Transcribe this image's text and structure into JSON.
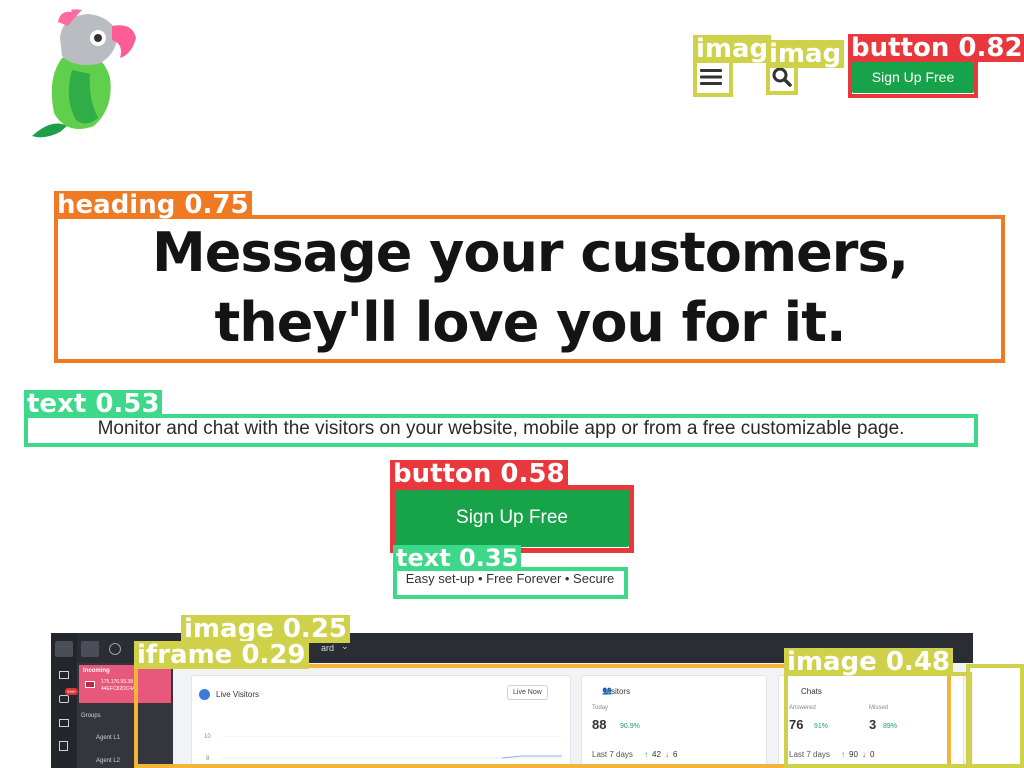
{
  "header": {
    "logo": "parrot-logo",
    "menu_icon": "hamburger-icon",
    "search_icon": "search-icon",
    "signup_label": "Sign Up Free"
  },
  "hero": {
    "title_line1": "Message your customers,",
    "title_line2": "they'll love you for it.",
    "subtitle": "Monitor and chat with the visitors on your website, mobile app or from a free customizable page.",
    "cta_label": "Sign Up Free",
    "tagline": "Easy set-up • Free Forever • Secure"
  },
  "dashboard": {
    "incoming_label": "Incoming",
    "incoming_ip": "175.176.93.38",
    "incoming_id": "44EFC82DC4A...",
    "incoming_badge": "999+",
    "groups_label": "Groups",
    "agent1": "Agent L1",
    "agent2": "Agent L2",
    "dropdown_suffix": "ard",
    "live_visitors": "Live Visitors",
    "live_now": "Live Now",
    "chart_tick_10": "10",
    "chart_tick_8": "8",
    "visitors_title": "Visitors",
    "visitors_today_label": "Today",
    "visitors_today_value": "88",
    "visitors_today_pct": "90.9%",
    "visitors_last7_label": "Last 7 days",
    "visitors_last7_up": "42",
    "visitors_last7_down": "6",
    "chats_title": "Chats",
    "chats_answered_label": "Answered",
    "chats_answered_value": "76",
    "chats_answered_pct": "91%",
    "chats_missed_label": "Missed",
    "chats_missed_value": "3",
    "chats_missed_pct": "89%",
    "chats_last7_label": "Last 7 days",
    "chats_last7_up": "90",
    "chats_last7_down": "0"
  },
  "detections": {
    "heading": "heading 0.75",
    "text1": "text 0.53",
    "button1": "button 0.58",
    "text2": "text 0.35",
    "image_top1": "imag",
    "image_top2": "imag",
    "button_top": "button 0.82",
    "image_dash": "image 0.25",
    "iframe": "iframe 0.29",
    "image_chats": "image 0.48"
  },
  "colors": {
    "brand_green": "#17a34a",
    "heading_box": "#f07a23",
    "button_box": "#e8383d",
    "text_box": "#3ed88b",
    "image_box": "#cfd14a"
  }
}
